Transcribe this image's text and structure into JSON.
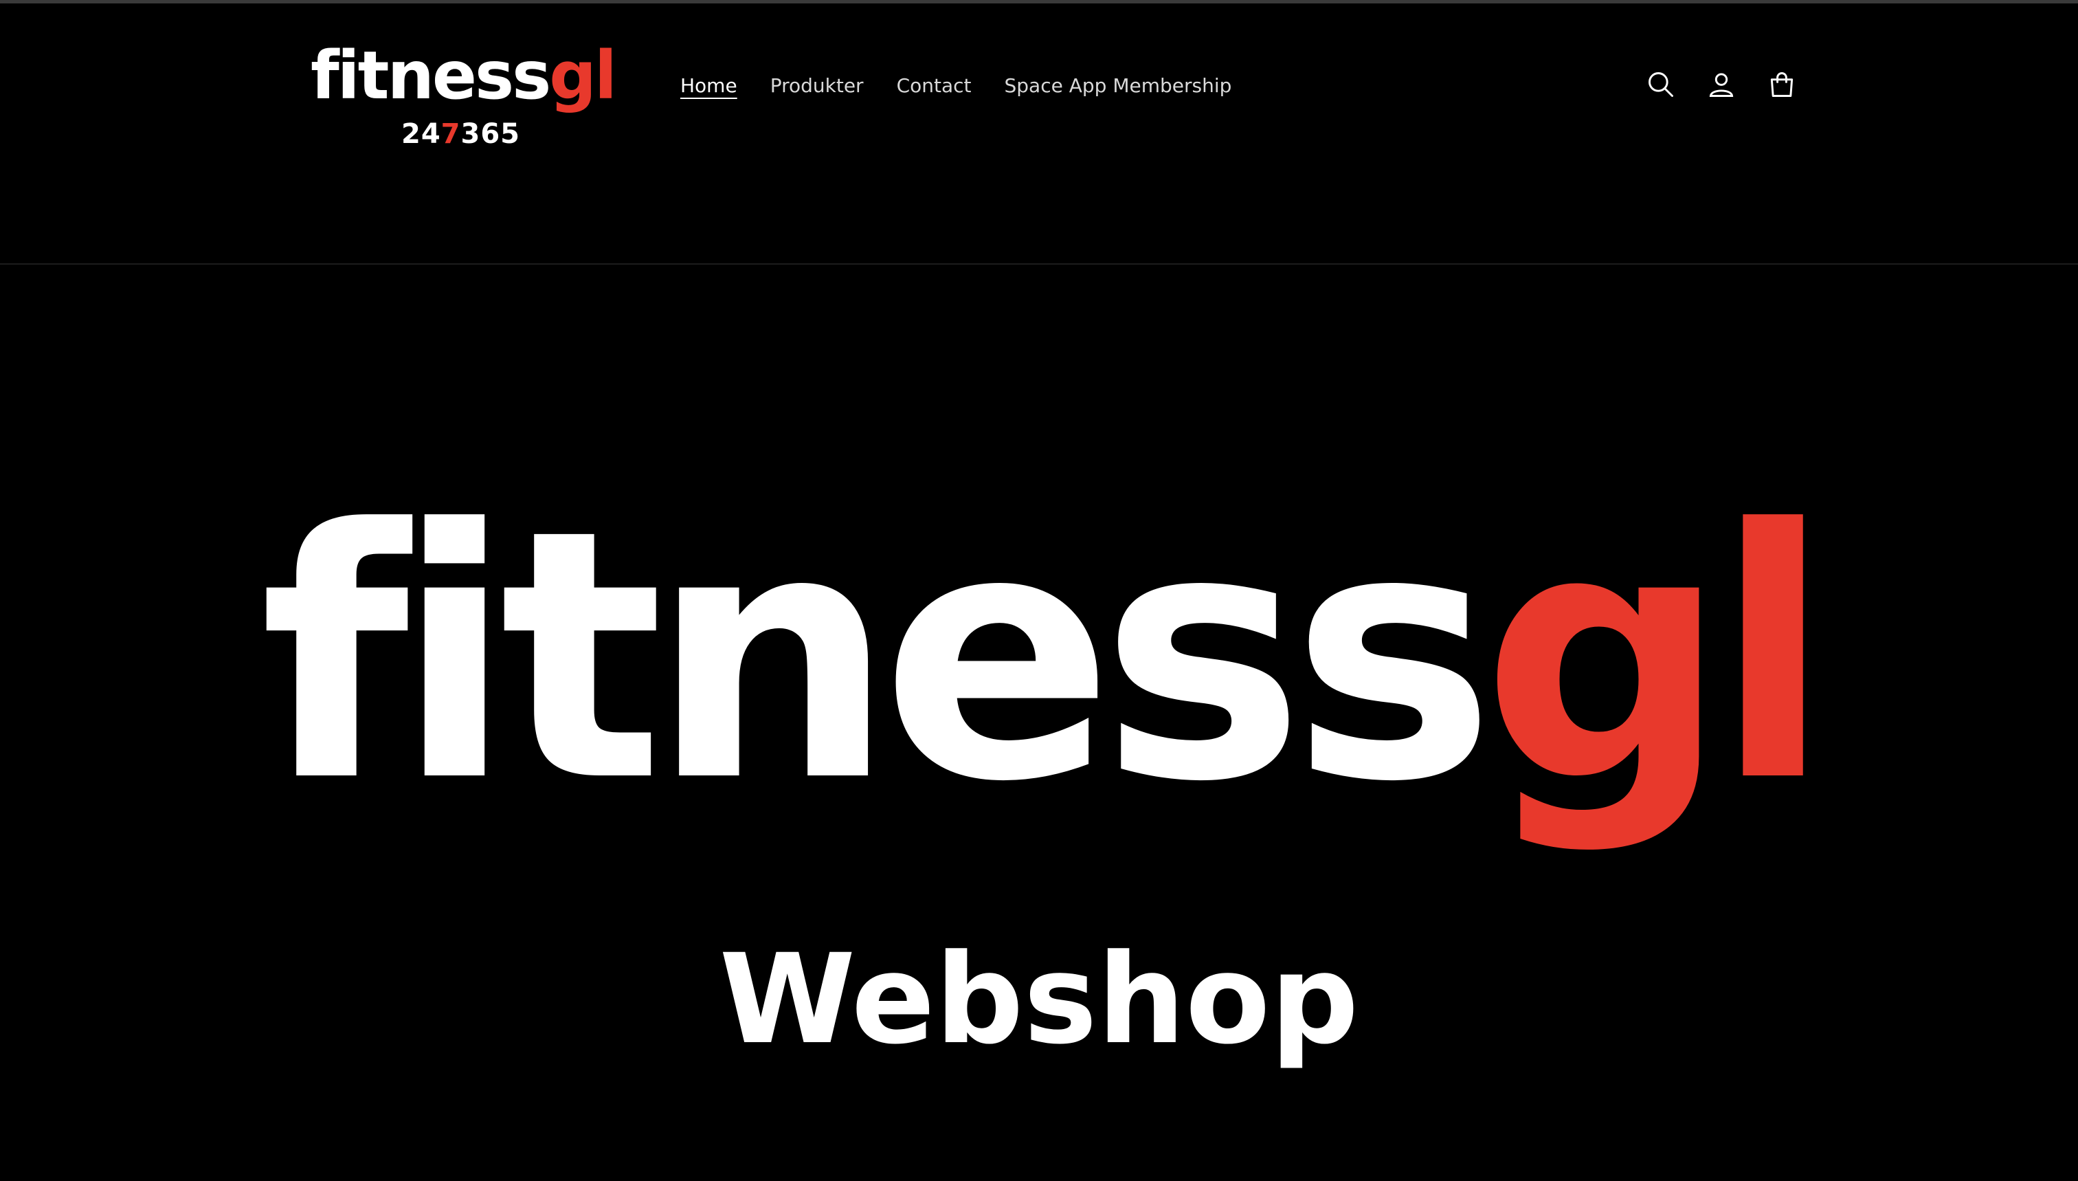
{
  "header": {
    "logo": {
      "word_white": "fitness",
      "word_red": "gl",
      "num_white_1": "24",
      "num_red": "7",
      "num_white_2": "365"
    },
    "nav": [
      {
        "label": "Home",
        "active": true
      },
      {
        "label": "Produkter",
        "active": false
      },
      {
        "label": "Contact",
        "active": false
      },
      {
        "label": "Space App Membership",
        "active": false
      }
    ],
    "icons": [
      "search-icon",
      "account-icon",
      "cart-icon"
    ]
  },
  "hero": {
    "word_white": "fitness",
    "word_red": "gl",
    "subtitle": "Webshop"
  },
  "colors": {
    "background": "#000000",
    "accent_red": "#e8392c",
    "text": "#ffffff"
  }
}
